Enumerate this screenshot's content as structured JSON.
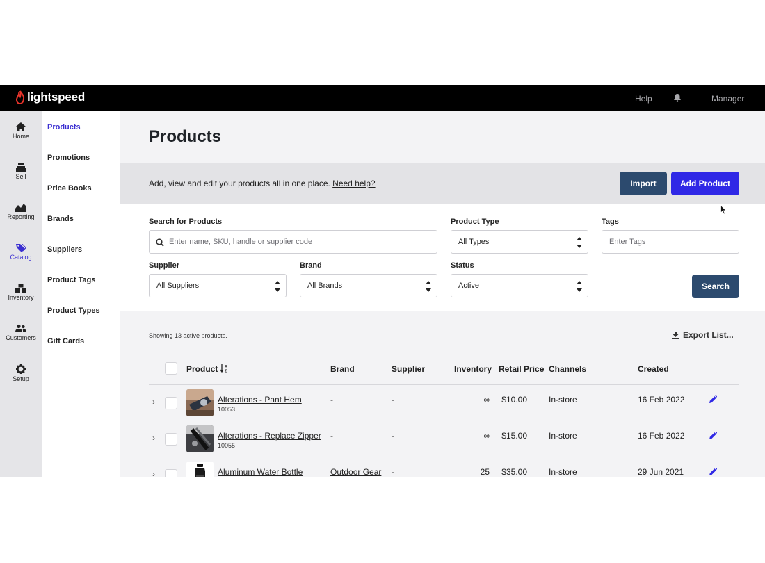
{
  "topbar": {
    "brand": "lightspeed",
    "help": "Help",
    "user": "Manager"
  },
  "rail": [
    {
      "label": "Home",
      "icon": "home-icon"
    },
    {
      "label": "Sell",
      "icon": "register-icon"
    },
    {
      "label": "Reporting",
      "icon": "chart-icon"
    },
    {
      "label": "Catalog",
      "icon": "tag-icon",
      "active": true
    },
    {
      "label": "Inventory",
      "icon": "boxes-icon"
    },
    {
      "label": "Customers",
      "icon": "people-icon"
    },
    {
      "label": "Setup",
      "icon": "gear-icon"
    }
  ],
  "subnav": [
    "Products",
    "Promotions",
    "Price Books",
    "Brands",
    "Suppliers",
    "Product Tags",
    "Product Types",
    "Gift Cards"
  ],
  "page": {
    "title": "Products",
    "description": "Add, view and edit your products all in one place.",
    "help_link": "Need help?",
    "import_label": "Import",
    "add_label": "Add Product"
  },
  "filters": {
    "search_label": "Search for Products",
    "search_placeholder": "Enter name, SKU, handle or supplier code",
    "type_label": "Product Type",
    "type_value": "All Types",
    "tags_label": "Tags",
    "tags_placeholder": "Enter Tags",
    "supplier_label": "Supplier",
    "supplier_value": "All Suppliers",
    "brand_label": "Brand",
    "brand_value": "All Brands",
    "status_label": "Status",
    "status_value": "Active",
    "search_button": "Search"
  },
  "list": {
    "showing": "Showing 13 active products.",
    "export_label": "Export List...",
    "columns": [
      "Product",
      "Brand",
      "Supplier",
      "Inventory",
      "Retail Price",
      "Channels",
      "Created"
    ],
    "rows": [
      {
        "name": "Alterations - Pant Hem",
        "sku": "10053",
        "brand": "-",
        "supplier": "-",
        "inventory": "∞",
        "price": "$10.00",
        "channels": "In-store",
        "created": "16 Feb 2022"
      },
      {
        "name": "Alterations - Replace Zipper",
        "sku": "10055",
        "brand": "-",
        "supplier": "-",
        "inventory": "∞",
        "price": "$15.00",
        "channels": "In-store",
        "created": "16 Feb 2022"
      },
      {
        "name": "Aluminum Water Bottle",
        "sku": "",
        "brand": "Outdoor Gear",
        "supplier": "-",
        "inventory": "25",
        "price": "$35.00",
        "channels": "In-store",
        "created": "29 Jun 2021"
      }
    ]
  },
  "colors": {
    "accent": "#2f28e6",
    "navy": "#2c4a6e",
    "active_nav": "#3b2fd1"
  }
}
